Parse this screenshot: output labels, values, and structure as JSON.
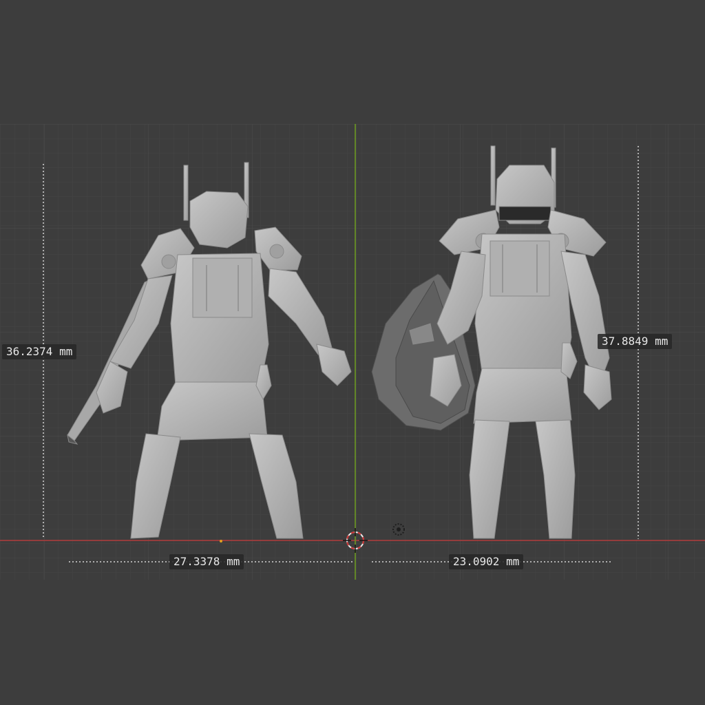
{
  "viewport": {
    "background_color": "#3d3d3d",
    "grid_color": "#474747",
    "grid_major_color": "#4c4c4c",
    "x_axis_color": "#b03a3a",
    "y_axis_color": "#6f9f1e",
    "model_color": "#b8b8b8"
  },
  "measurements": {
    "left_height": "36.2374 mm",
    "right_height": "37.8849 mm",
    "left_width": "27.3378 mm",
    "right_width": "23.0902 mm"
  },
  "models": {
    "left": "knight-back-view",
    "right": "knight-front-view-with-shield"
  },
  "icons": {
    "cursor": "3d-cursor-icon",
    "light": "light-icon"
  }
}
